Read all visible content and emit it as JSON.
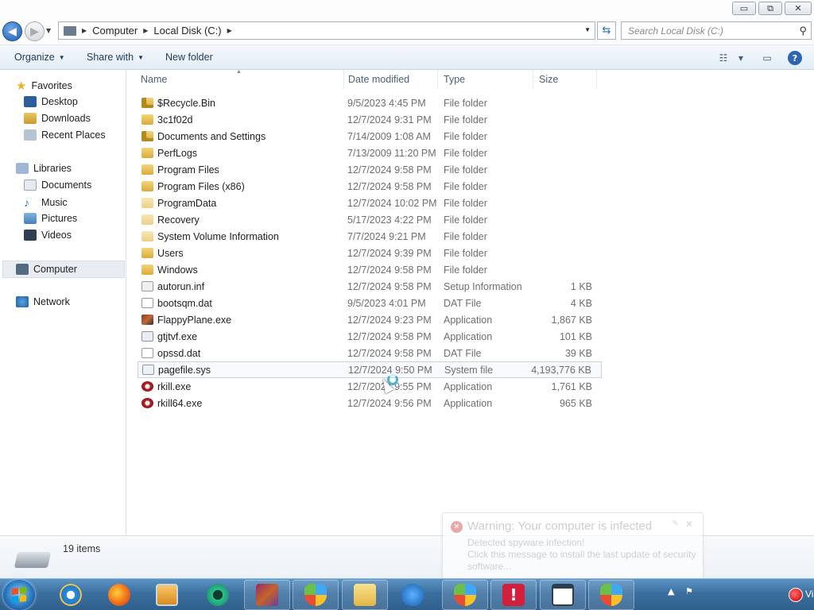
{
  "window": {
    "controls": {
      "minimize": "▭",
      "maximize": "⧉",
      "close": "✕"
    }
  },
  "address": {
    "crumbs": [
      "Computer",
      "Local Disk (C:)"
    ],
    "search_placeholder": "Search Local Disk (C:)"
  },
  "toolbar": {
    "organize": "Organize",
    "share_with": "Share with",
    "new_folder": "New folder"
  },
  "nav": {
    "favorites": "Favorites",
    "desktop": "Desktop",
    "downloads": "Downloads",
    "recent_places": "Recent Places",
    "libraries": "Libraries",
    "documents": "Documents",
    "music": "Music",
    "pictures": "Pictures",
    "videos": "Videos",
    "computer": "Computer",
    "network": "Network"
  },
  "columns": {
    "name": "Name",
    "date": "Date modified",
    "type": "Type",
    "size": "Size"
  },
  "files": [
    {
      "name": "$Recycle.Bin",
      "date": "9/5/2023 4:45 PM",
      "type": "File folder",
      "size": "",
      "icon": "folder-locked"
    },
    {
      "name": "3c1f02d",
      "date": "12/7/2024 9:31 PM",
      "type": "File folder",
      "size": "",
      "icon": "folder"
    },
    {
      "name": "Documents and Settings",
      "date": "7/14/2009 1:08 AM",
      "type": "File folder",
      "size": "",
      "icon": "folder-locked"
    },
    {
      "name": "PerfLogs",
      "date": "7/13/2009 11:20 PM",
      "type": "File folder",
      "size": "",
      "icon": "folder"
    },
    {
      "name": "Program Files",
      "date": "12/7/2024 9:58 PM",
      "type": "File folder",
      "size": "",
      "icon": "folder"
    },
    {
      "name": "Program Files (x86)",
      "date": "12/7/2024 9:58 PM",
      "type": "File folder",
      "size": "",
      "icon": "folder"
    },
    {
      "name": "ProgramData",
      "date": "12/7/2024 10:02 PM",
      "type": "File folder",
      "size": "",
      "icon": "folder-pale"
    },
    {
      "name": "Recovery",
      "date": "5/17/2023 4:22 PM",
      "type": "File folder",
      "size": "",
      "icon": "folder-pale"
    },
    {
      "name": "System Volume Information",
      "date": "7/7/2024 9:21 PM",
      "type": "File folder",
      "size": "",
      "icon": "folder-pale"
    },
    {
      "name": "Users",
      "date": "12/7/2024 9:39 PM",
      "type": "File folder",
      "size": "",
      "icon": "folder"
    },
    {
      "name": "Windows",
      "date": "12/7/2024 9:58 PM",
      "type": "File folder",
      "size": "",
      "icon": "folder"
    },
    {
      "name": "autorun.inf",
      "date": "12/7/2024 9:58 PM",
      "type": "Setup Information",
      "size": "1 KB",
      "icon": "file-inf"
    },
    {
      "name": "bootsqm.dat",
      "date": "9/5/2023 4:01 PM",
      "type": "DAT File",
      "size": "4 KB",
      "icon": "file-doc"
    },
    {
      "name": "FlappyPlane.exe",
      "date": "12/7/2024 9:23 PM",
      "type": "Application",
      "size": "1,867 KB",
      "icon": "file-exe"
    },
    {
      "name": "gtjtvf.exe",
      "date": "12/7/2024 9:58 PM",
      "type": "Application",
      "size": "101 KB",
      "icon": "file-exe2"
    },
    {
      "name": "opssd.dat",
      "date": "12/7/2024 9:58 PM",
      "type": "DAT File",
      "size": "39 KB",
      "icon": "file-doc"
    },
    {
      "name": "pagefile.sys",
      "date": "12/7/2024 9:50 PM",
      "type": "System file",
      "size": "4,193,776 KB",
      "icon": "file-sys"
    },
    {
      "name": "rkill.exe",
      "date": "12/7/2024 9:55 PM",
      "type": "Application",
      "size": "1,761 KB",
      "icon": "file-rkill"
    },
    {
      "name": "rkill64.exe",
      "date": "12/7/2024 9:56 PM",
      "type": "Application",
      "size": "965 KB",
      "icon": "file-rkill"
    }
  ],
  "status": {
    "item_count": "19 items"
  },
  "popup": {
    "title": "Warning: Your computer is infected",
    "line1": "Detected spyware infection!",
    "line2": "Click this message to install the last update of security software..."
  },
  "taskbar": {
    "apps": [
      "internet-explorer",
      "firefox",
      "media-player",
      "app-green",
      "winrar",
      "windows-security",
      "explorer",
      "security-shield-plus",
      "windows-shield",
      "alert-app",
      "window-app",
      "security-shield"
    ],
    "tray_label": "Vi"
  }
}
